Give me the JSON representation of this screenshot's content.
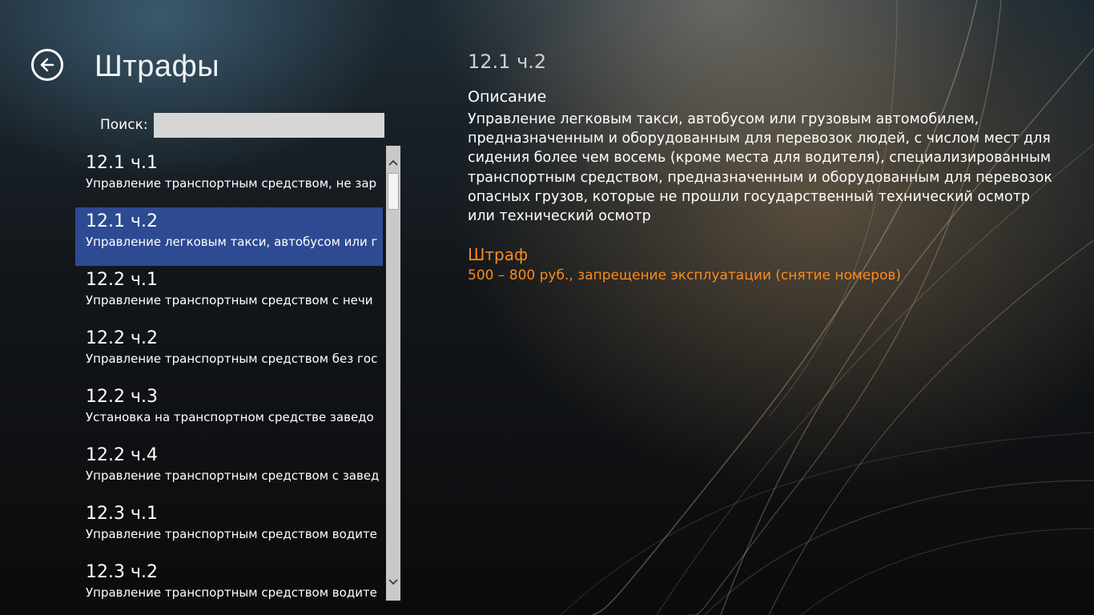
{
  "header": {
    "title": "Штрафы"
  },
  "search": {
    "label": "Поиск:",
    "value": "",
    "placeholder": ""
  },
  "list": {
    "items": [
      {
        "code": "12.1 ч.1",
        "desc": "Управление транспортным средством, не зар"
      },
      {
        "code": "12.1 ч.2",
        "desc": "Управление легковым такси, автобусом или г",
        "selected": true
      },
      {
        "code": "12.2 ч.1",
        "desc": "Управление транспортным средством с нечи"
      },
      {
        "code": "12.2 ч.2",
        "desc": "Управление транспортным средством без гос"
      },
      {
        "code": "12.2 ч.3",
        "desc": "Установка на транспортном средстве заведо"
      },
      {
        "code": "12.2 ч.4",
        "desc": "Управление транспортным средством с завед"
      },
      {
        "code": "12.3 ч.1",
        "desc": "Управление транспортным средством водите"
      },
      {
        "code": "12.3 ч.2",
        "desc": "Управление транспортным средством водите"
      }
    ]
  },
  "scrollbar": {
    "position_fraction": 0.0
  },
  "detail": {
    "code": "12.1 ч.2",
    "description_heading": "Описание",
    "description": "Управление легковым такси, автобусом или грузовым автомобилем, предназначенным и оборудованным для перевозок людей, с числом мест для сидения более чем восемь (кроме места для водителя), специализированным транспортным средством, предназначенным и оборудованным для перевозок опасных грузов, которые не прошли государственный технический осмотр или технический осмотр",
    "fine_heading": "Штраф",
    "fine": "500 – 800 руб., запрещение эксплуатации (снятие номеров)"
  },
  "icons": {
    "back": "back-arrow-icon",
    "scroll_up": "chevron-up-icon",
    "scroll_down": "chevron-down-icon"
  },
  "colors": {
    "selection": "#2e4a92",
    "fine_accent": "#ff8a1c",
    "scrollbar_track": "#c9c9c9"
  }
}
